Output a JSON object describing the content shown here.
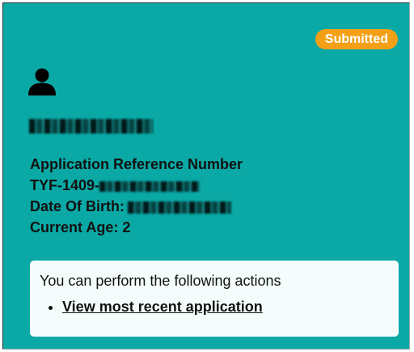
{
  "card": {
    "status_badge": "Submitted",
    "status_color": "#f3a016",
    "background_color": "#0aa9a6",
    "icon": "person-icon",
    "applicant_name": "",
    "reference_label": "Application Reference Number",
    "reference_prefix": "TYF-1409-",
    "dob_label": "Date Of Birth:",
    "current_age": "Current Age: 2"
  },
  "actions": {
    "intro": "You can perform the following actions",
    "links": [
      {
        "label": "View most recent application"
      }
    ]
  }
}
